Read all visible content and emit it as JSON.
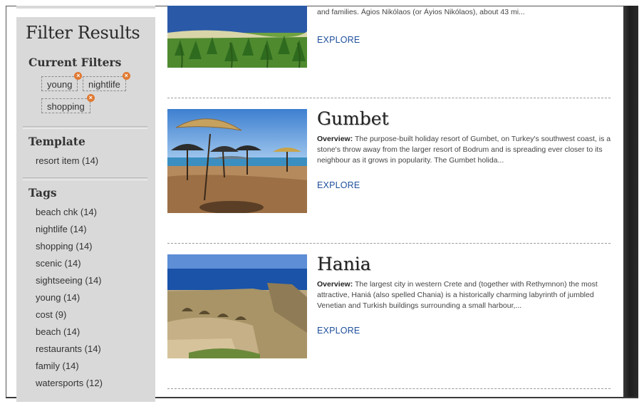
{
  "sidebar": {
    "title": "Filter Results",
    "current_filters": {
      "heading": "Current Filters",
      "chips": [
        {
          "label": "young"
        },
        {
          "label": "nightlife"
        },
        {
          "label": "shopping"
        }
      ],
      "remove_glyph": "×"
    },
    "template": {
      "heading": "Template",
      "items": [
        {
          "label": "resort item (14)"
        }
      ]
    },
    "tags": {
      "heading": "Tags",
      "items": [
        {
          "label": "beach chk (14)"
        },
        {
          "label": "nightlife (14)"
        },
        {
          "label": "shopping (14)"
        },
        {
          "label": "scenic (14)"
        },
        {
          "label": "sightseeing (14)"
        },
        {
          "label": "young (14)"
        },
        {
          "label": "cost (9)"
        },
        {
          "label": "beach (14)"
        },
        {
          "label": "restaurants (14)"
        },
        {
          "label": "family (14)"
        },
        {
          "label": "watersports (12)"
        }
      ]
    }
  },
  "results": [
    {
      "title": "",
      "overview_label": "",
      "description": "and families. Ágios Nikólaos (or Áyios Nikólaos), about 43 mi...",
      "explore": "EXPLORE",
      "image": "palm-beach-photo"
    },
    {
      "title": "Gumbet",
      "overview_label": "Overview:",
      "description": "The purpose-built holiday resort of Gumbet, on Turkey's southwest coast, is a stone's throw away from the larger resort of Bodrum and is spreading ever closer to its neighbour as it grows in popularity. The Gumbet holida...",
      "explore": "EXPLORE",
      "image": "beach-umbrellas-photo"
    },
    {
      "title": "Hania",
      "overview_label": "Overview:",
      "description": "The largest city in western Crete and (together with Rethymnon) the most attractive, Haniá (also spelled Chania) is a historically charming labyrinth of jumbled Venetian and Turkish buildings surrounding a small harbour,...",
      "explore": "EXPLORE",
      "image": "fortress-ruins-photo"
    }
  ],
  "colors": {
    "sidebar_bg": "#d9d9d9",
    "link": "#1e4f9c",
    "chip_remove": "#e07a33"
  }
}
